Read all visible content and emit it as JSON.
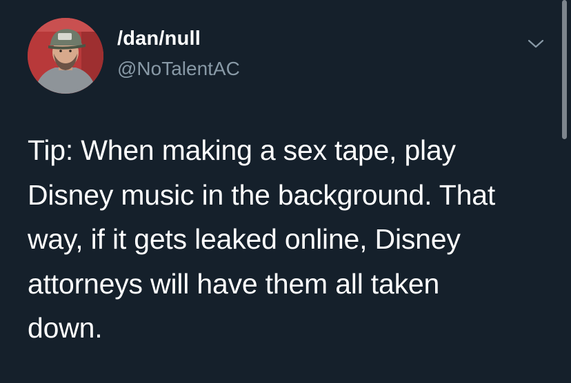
{
  "tweet": {
    "author": {
      "display_name": "/dan/null",
      "handle": "@NoTalentAC",
      "avatar_icon": "user-photo-avatar"
    },
    "menu_icon": "chevron-down-icon",
    "text_lines": [
      "Tip: When making a sex tape, play",
      "Disney music in the background. That",
      "way, if it gets leaked online, Disney",
      "attorneys will have them all taken",
      "down."
    ]
  },
  "colors": {
    "background": "#15202b",
    "primary_text": "#ffffff",
    "secondary_text": "#8899a6"
  }
}
